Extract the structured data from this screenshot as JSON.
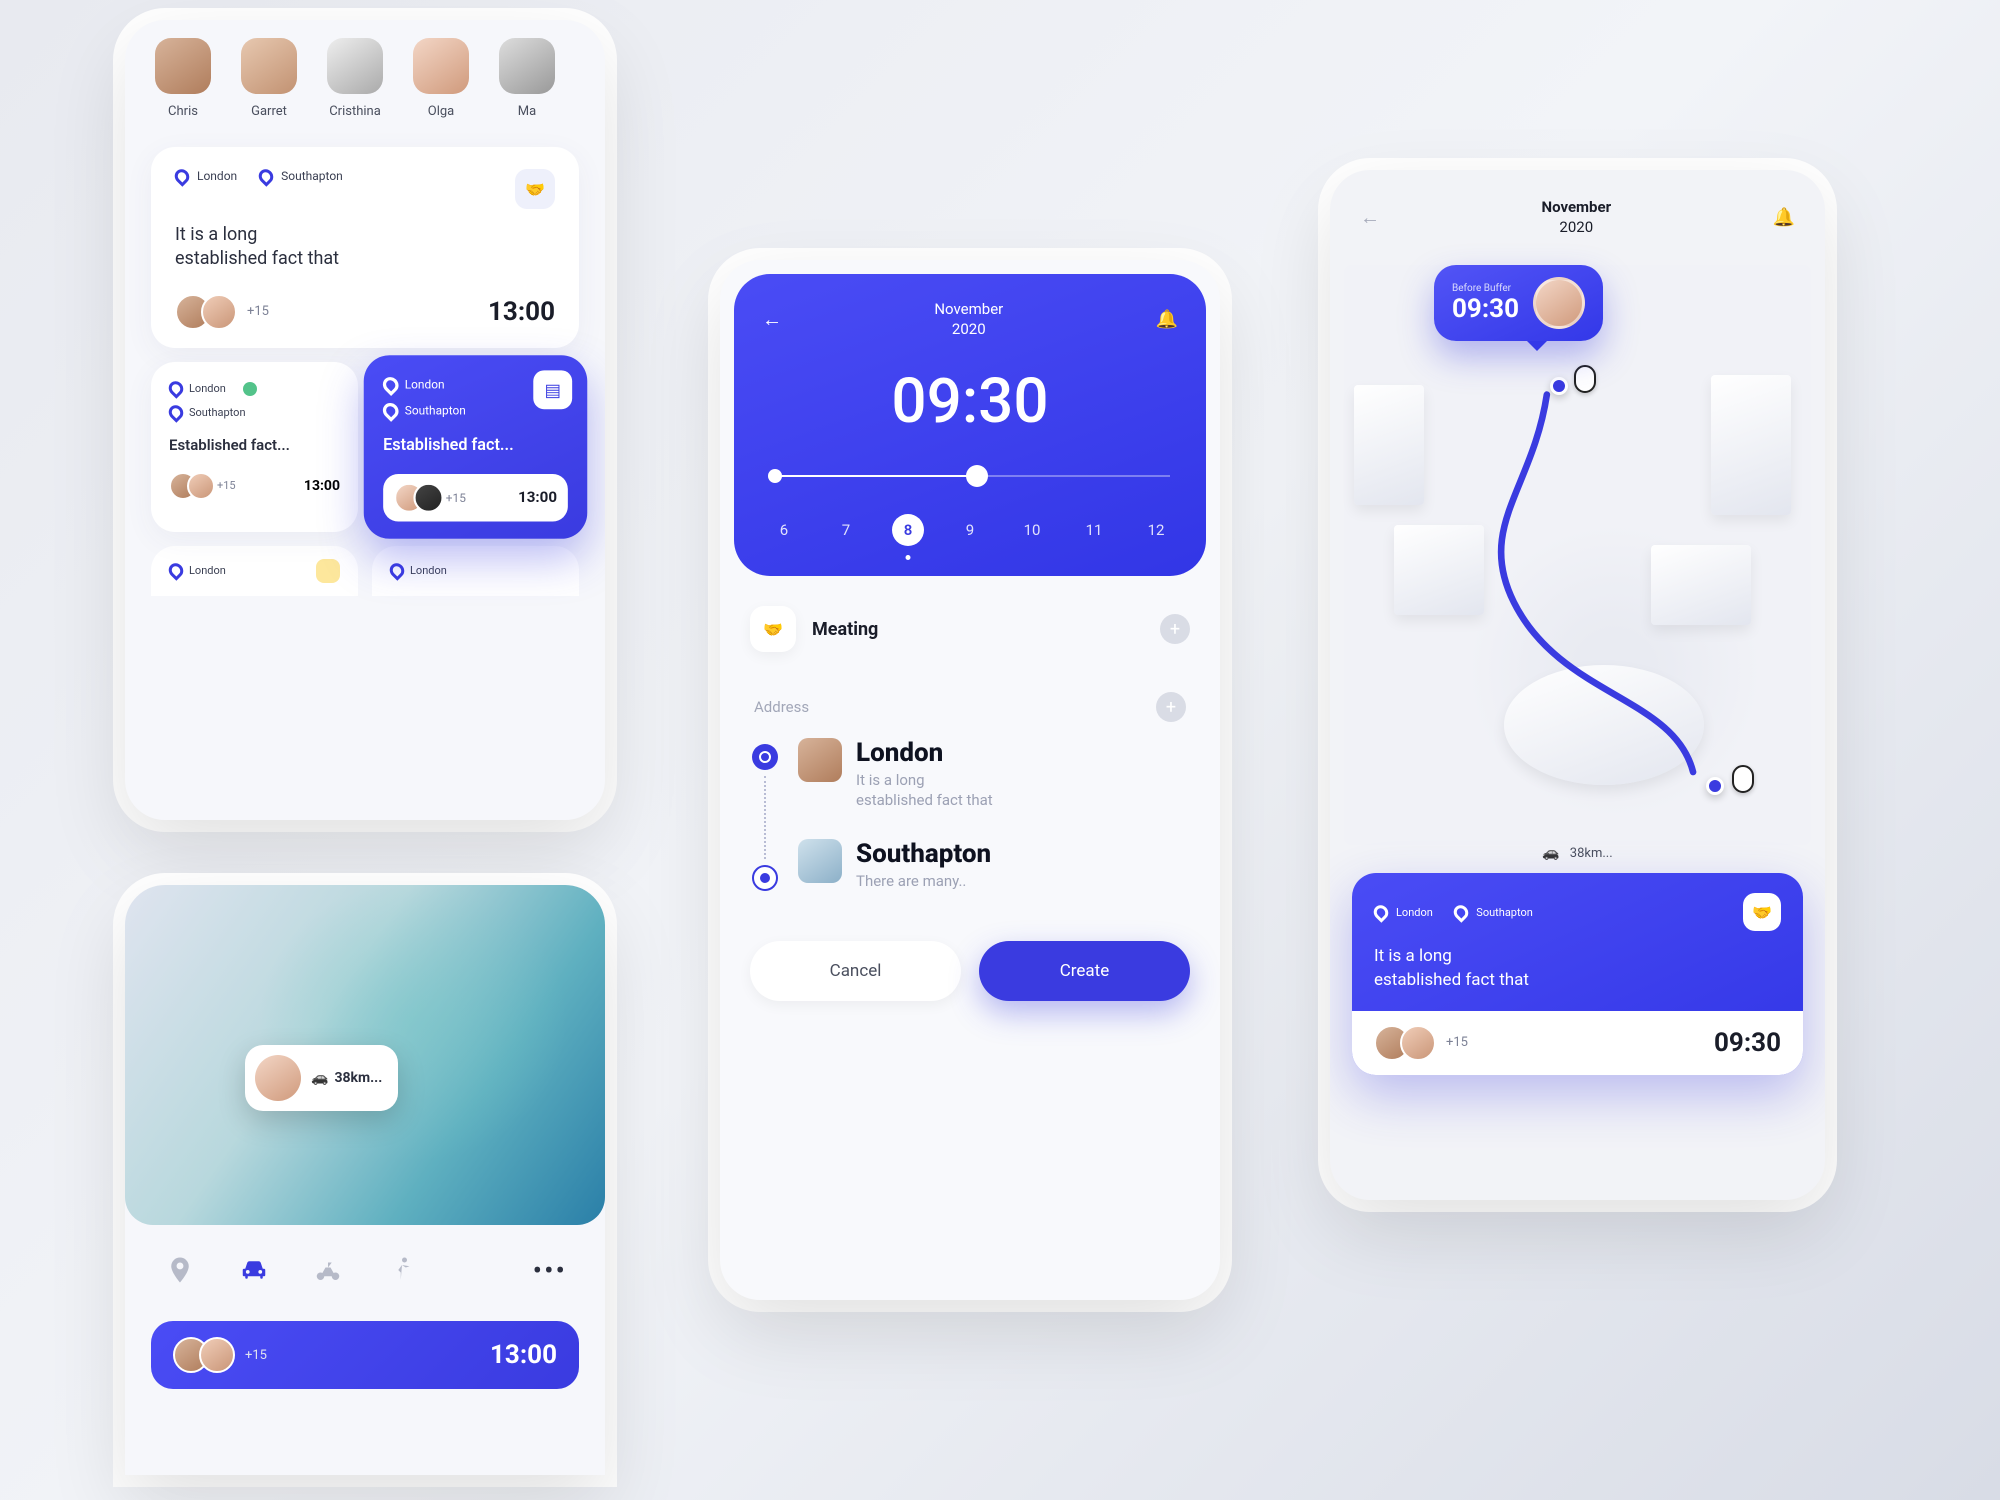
{
  "contacts": [
    {
      "name": "Chris"
    },
    {
      "name": "Garret"
    },
    {
      "name": "Cristhina"
    },
    {
      "name": "Olga"
    },
    {
      "name": "Ma"
    }
  ],
  "card_big": {
    "loc1": "London",
    "loc2": "Southapton",
    "desc": "It is a long\nestablished fact that",
    "plus": "+15",
    "time": "13:00"
  },
  "mini_left": {
    "loc1": "London",
    "loc2": "Southapton",
    "title": "Established fact...",
    "plus": "+15",
    "time": "13:00"
  },
  "mini_right": {
    "loc1": "London",
    "loc2": "Southapton",
    "title": "Established fact...",
    "plus": "+15",
    "time": "13:00"
  },
  "stub1": "London",
  "stub2": "London",
  "leaf": {
    "distance": "38km..."
  },
  "transport_footer": {
    "plus": "+15",
    "time": "13:00"
  },
  "picker": {
    "month": "November",
    "year": "2020",
    "time": "09:30",
    "days": [
      "6",
      "7",
      "8",
      "9",
      "10",
      "11",
      "12"
    ],
    "selected_day": "8"
  },
  "meeting_label": "Meating",
  "address_label": "Address",
  "route": [
    {
      "city": "London",
      "sub": "It is a long\nestablished fact that"
    },
    {
      "city": "Southapton",
      "sub": "There are many.."
    }
  ],
  "buttons": {
    "cancel": "Cancel",
    "create": "Create"
  },
  "map_header": {
    "month": "November",
    "year": "2020"
  },
  "buffer": {
    "label": "Before Buffer",
    "time": "09:30"
  },
  "map_distance": "38km...",
  "map_card": {
    "loc1": "London",
    "loc2": "Southapton",
    "desc": "It is a long\nestablished fact that",
    "plus": "+15",
    "time": "09:30"
  }
}
